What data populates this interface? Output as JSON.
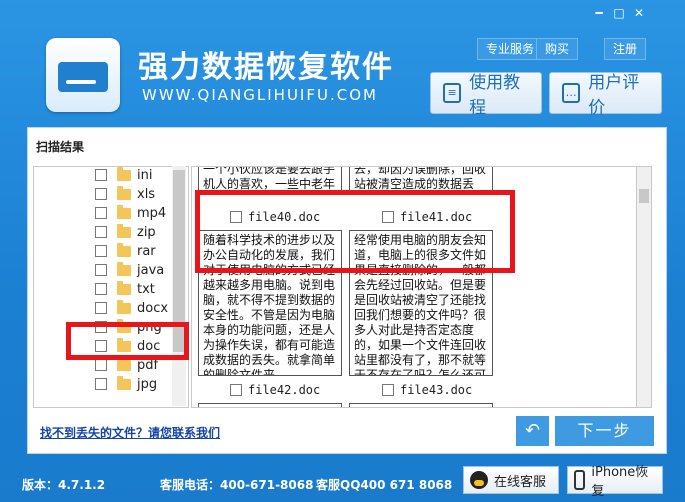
{
  "app": {
    "title": "强力数据恢复软件",
    "site": "WWW.QIANGLIHUIFU.COM",
    "top_buttons": [
      "专业服务",
      "购买",
      "注册"
    ],
    "guide_btn": "使用教程",
    "review_btn": "用户评价"
  },
  "panel": {
    "title": "扫描结果"
  },
  "tree": {
    "items": [
      "ini",
      "xls",
      "mp4",
      "zip",
      "rar",
      "java",
      "txt",
      "docx",
      "png",
      "doc",
      "pdf",
      "jpg"
    ]
  },
  "grid": {
    "top_left_text": "一个小伙应该是要去跟手机人的喜欢，一些中老年人如何打开微信一些通话功能",
    "top_right_text": "去，却因为误删除，回收站被清空造成的数据丢失，这有助于系统处理了记",
    "mid_left_text": "随着科学技术的进步以及办公自动化的发展，我们对于使用电脑的方式已经越来越多用电脑。说到电脑，就不得不提到数据的安全性。不管是因为电脑本身的功能问题，还是人为操作失误，都有可能造成数据的丢失。就拿简单的删除文件来",
    "mid_right_text": "经常使用电脑的朋友会知道，电脑上的很多文件如果是直接删除的，一般都会先经过回收站。但是要是回收站被清空了还能找回我们想要的文件吗？很多人对此是持否定态度的，如果一个文件连回收站里都没有了，那不就等于不存在了吗？怎么还可",
    "files": [
      "file40.doc",
      "file41.doc",
      "file42.doc",
      "file43.doc"
    ]
  },
  "link": "找不到丢失的文件？请您联系我们",
  "next_btn": "下一步",
  "footer": {
    "version": "版本：4.7.1.2",
    "phone": "客服电话：400-671-8068",
    "qq": "客服QQ400 671 8068",
    "online_service": "在线客服",
    "iphone_recover": "iPhone恢复"
  },
  "colors": {
    "highlight": "#e8161b",
    "accent": "#1f86d6"
  }
}
